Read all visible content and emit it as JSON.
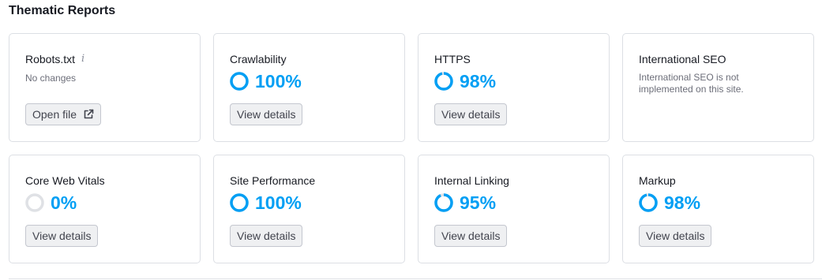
{
  "section": {
    "title": "Thematic Reports"
  },
  "cards": [
    {
      "title": "Robots.txt",
      "subtitle": "No changes",
      "button": "Open file",
      "info_icon": "info-icon",
      "button_icon": "external-link-icon"
    },
    {
      "title": "Crawlability",
      "percent": 100,
      "percent_label": "100%",
      "button": "View details"
    },
    {
      "title": "HTTPS",
      "percent": 98,
      "percent_label": "98%",
      "button": "View details"
    },
    {
      "title": "International SEO",
      "subtitle": "International SEO is not implemented on this site."
    },
    {
      "title": "Core Web Vitals",
      "percent": 0,
      "percent_label": "0%",
      "button": "View details"
    },
    {
      "title": "Site Performance",
      "percent": 100,
      "percent_label": "100%",
      "button": "View details"
    },
    {
      "title": "Internal Linking",
      "percent": 95,
      "percent_label": "95%",
      "button": "View details"
    },
    {
      "title": "Markup",
      "percent": 98,
      "percent_label": "98%",
      "button": "View details"
    }
  ],
  "colors": {
    "accent": "#009ff4",
    "ring_track": "#dfe1e5",
    "card_border": "#dcdfe4",
    "button_bg": "#eff0f2"
  }
}
